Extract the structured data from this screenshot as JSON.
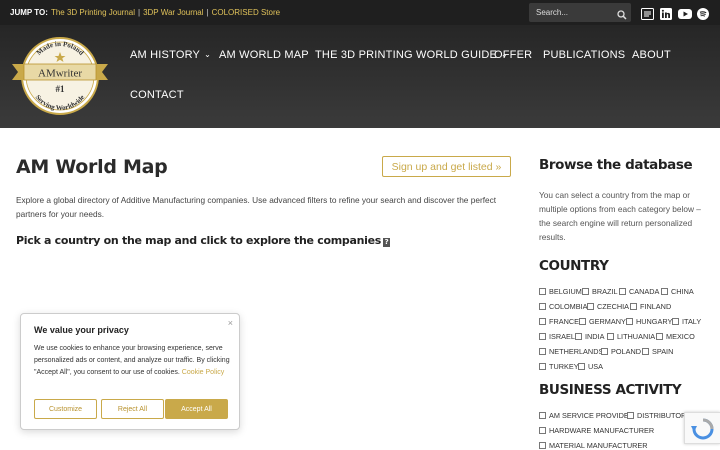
{
  "topbar": {
    "jump_label": "JUMP TO:",
    "links": [
      "The 3D Printing Journal",
      "3DP War Journal",
      "COLORISED Store"
    ],
    "separator": "|",
    "search_placeholder": "Search...",
    "social_icons": [
      "rss-icon",
      "linkedin-icon",
      "youtube-icon",
      "spotify-icon"
    ]
  },
  "logo": {
    "text_top": "Made in Poland",
    "text_name": "AMwriter",
    "text_rank": "#1",
    "text_bottom": "Serving Worldwide"
  },
  "nav": {
    "items": [
      {
        "label": "AM HISTORY",
        "dropdown": true
      },
      {
        "label": "AM WORLD MAP",
        "dropdown": false
      },
      {
        "label": "THE 3D PRINTING WORLD GUIDE",
        "dropdown": true
      },
      {
        "label": "OFFER",
        "dropdown": false
      },
      {
        "label": "PUBLICATIONS",
        "dropdown": false
      },
      {
        "label": "ABOUT",
        "dropdown": false
      },
      {
        "label": "CONTACT",
        "dropdown": false
      }
    ],
    "chevron": "⌄"
  },
  "main": {
    "title": "AM World Map",
    "signup_label": "Sign up and get listed",
    "signup_icon": "»",
    "intro": "Explore a global directory of Additive Manufacturing companies. Use advanced filters to refine your search and discover the perfect partners for your needs.",
    "pick": "Pick a country on the map and click to explore the companies",
    "pick_badge": "?"
  },
  "sidebar": {
    "title": "Browse the database",
    "description": "You can select a country from the map or multiple options from each category below – the search engine will return personalized results.",
    "country_heading": "COUNTRY",
    "countries": [
      "BELGIUM",
      "BRAZIL",
      "CANADA",
      "CHINA",
      "COLOMBIA",
      "CZECHIA",
      "FINLAND",
      "FRANCE",
      "GERMANY",
      "HUNGARY",
      "ITALY",
      "ISRAEL",
      "INDIA",
      "LITHUANIA",
      "MEXICO",
      "NETHERLANDS",
      "POLAND",
      "SPAIN",
      "TURKEY",
      "USA"
    ],
    "activity_heading": "BUSINESS ACTIVITY",
    "activities": [
      "AM SERVICE PROVIDER",
      "DISTRIBUTOR",
      "HARDWARE MANUFACTURER",
      "MATERIAL MANUFACTURER"
    ]
  },
  "cookie": {
    "title": "We value your privacy",
    "close": "×",
    "text": "We use cookies to enhance your browsing experience, serve personalized ads or content, and analyze our traffic. By clicking \"Accept All\", you consent to our use of cookies.",
    "policy_link": "Cookie Policy",
    "buttons": {
      "customize": "Customize",
      "reject": "Reject All",
      "accept": "Accept All"
    }
  },
  "colors": {
    "accent": "#c9a94a",
    "topbar": "#1f1f1f",
    "header": "#2f2f2f"
  }
}
